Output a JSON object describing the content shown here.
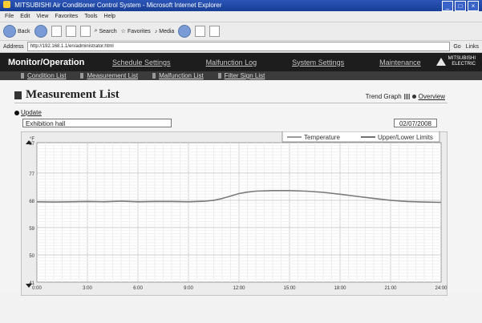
{
  "browser": {
    "title": "MITSUBISHI Air Conditioner Control System - Microsoft Internet Explorer",
    "menu": [
      "File",
      "Edit",
      "View",
      "Favorites",
      "Tools",
      "Help"
    ],
    "toolbar": {
      "back": "Back",
      "search": "Search",
      "favorites": "Favorites",
      "media": "Media"
    },
    "address_label": "Address",
    "url": "http://192.168.1.1/en/administrator.html",
    "go": "Go",
    "links": "Links"
  },
  "nav": {
    "title": "Monitor/Operation",
    "links": [
      "Schedule Settings",
      "Malfunction Log",
      "System Settings",
      "Maintenance"
    ],
    "logo_line1": "MITSUBISHI",
    "logo_line2": "ELECTRIC"
  },
  "subnav": [
    "Condition List",
    "Measurement List",
    "Malfunction List",
    "Filter Sign List"
  ],
  "page": {
    "title": "Measurement List",
    "trend_label": "Trend Graph",
    "overview": "Overview",
    "update": "Update",
    "location": "Exhibition hall",
    "date": "02/07/2008"
  },
  "chart_data": {
    "type": "line",
    "ylabel": "°F",
    "ylim": [
      41,
      87
    ],
    "yticks": [
      "87",
      "77",
      "68",
      "59",
      "50",
      "41"
    ],
    "xticks": [
      "0:00",
      "3:00",
      "6:00",
      "9:00",
      "12:00",
      "15:00",
      "18:00",
      "21:00",
      "24:00"
    ],
    "xlim": [
      0,
      24
    ],
    "legend": [
      "Temperature",
      "Upper/Lower Limits"
    ],
    "legend_position": "top-right",
    "grid": true,
    "series": [
      {
        "name": "Temperature",
        "color": "#7a7a7a",
        "x": [
          0,
          1,
          2,
          3,
          4,
          5,
          6,
          7,
          8,
          9,
          10,
          10.5,
          11,
          11.5,
          12,
          12.5,
          13,
          14,
          15,
          16,
          17,
          18,
          19,
          20,
          21,
          22,
          23,
          24
        ],
        "y": [
          67.5,
          67.4,
          67.5,
          67.6,
          67.5,
          67.7,
          67.5,
          67.6,
          67.6,
          67.5,
          67.7,
          68.0,
          68.6,
          69.4,
          70.2,
          70.7,
          71.0,
          71.2,
          71.2,
          71.0,
          70.6,
          70.0,
          69.3,
          68.6,
          68.0,
          67.6,
          67.4,
          67.3
        ]
      }
    ]
  }
}
